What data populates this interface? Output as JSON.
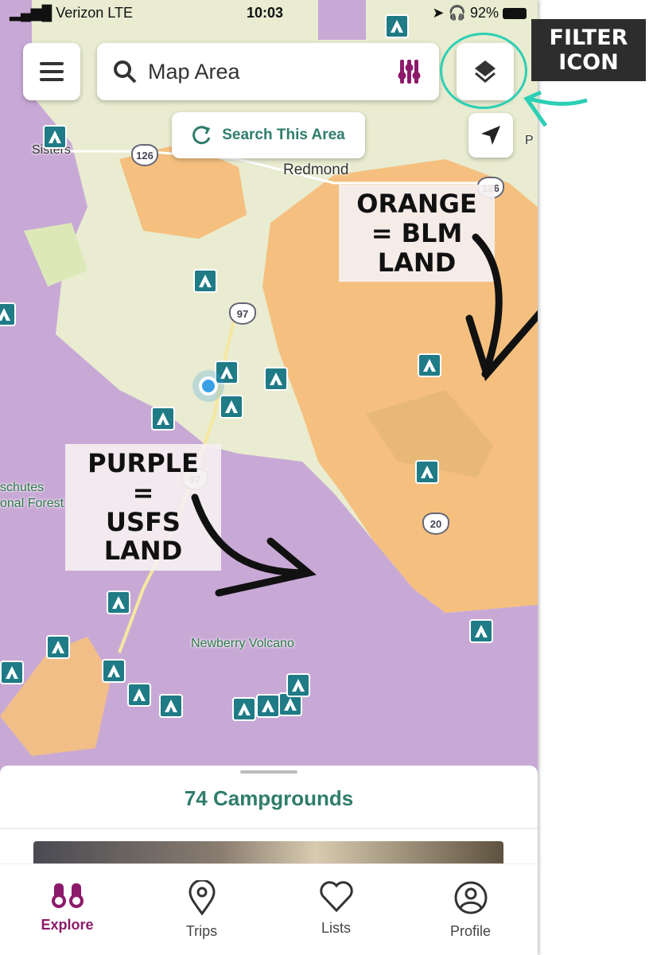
{
  "status": {
    "carrier": "Verizon",
    "network": "LTE",
    "time": "10:03",
    "battery": "92%"
  },
  "search": {
    "placeholder": "Map Area",
    "icon": "search-icon",
    "filter_icon": "sliders-icon"
  },
  "buttons": {
    "menu": "hamburger-icon",
    "layers": "layers-icon",
    "location": "navigation-arrow-icon",
    "search_area": "Search This Area"
  },
  "map": {
    "labels": {
      "sisters": "Sisters",
      "redmond": "Redmond",
      "forest1": "schutes",
      "forest2": "onal Forest",
      "newberry": "Newberry Volcano",
      "edge": "P"
    },
    "shields": [
      "126",
      "126",
      "97",
      "97",
      "20"
    ],
    "colors": {
      "blm": "#f5c07f",
      "usfs": "#c8a9d6",
      "base": "#e9ecd0",
      "marker": "#1f7b86"
    }
  },
  "annotations": {
    "filter": "FILTER ICON",
    "blm": "ORANGE = BLM LAND",
    "usfs": "PURPLE = USFS LAND"
  },
  "sheet": {
    "title": "74 Campgrounds"
  },
  "tabs": [
    {
      "label": "Explore",
      "icon": "binoculars-icon",
      "active": true
    },
    {
      "label": "Trips",
      "icon": "map-pin-icon"
    },
    {
      "label": "Lists",
      "icon": "heart-icon"
    },
    {
      "label": "Profile",
      "icon": "user-circle-icon"
    }
  ],
  "accent": {
    "primary": "#2f7d6b",
    "active_tab": "#8c1a6a",
    "highlight": "#2ccfb5"
  }
}
